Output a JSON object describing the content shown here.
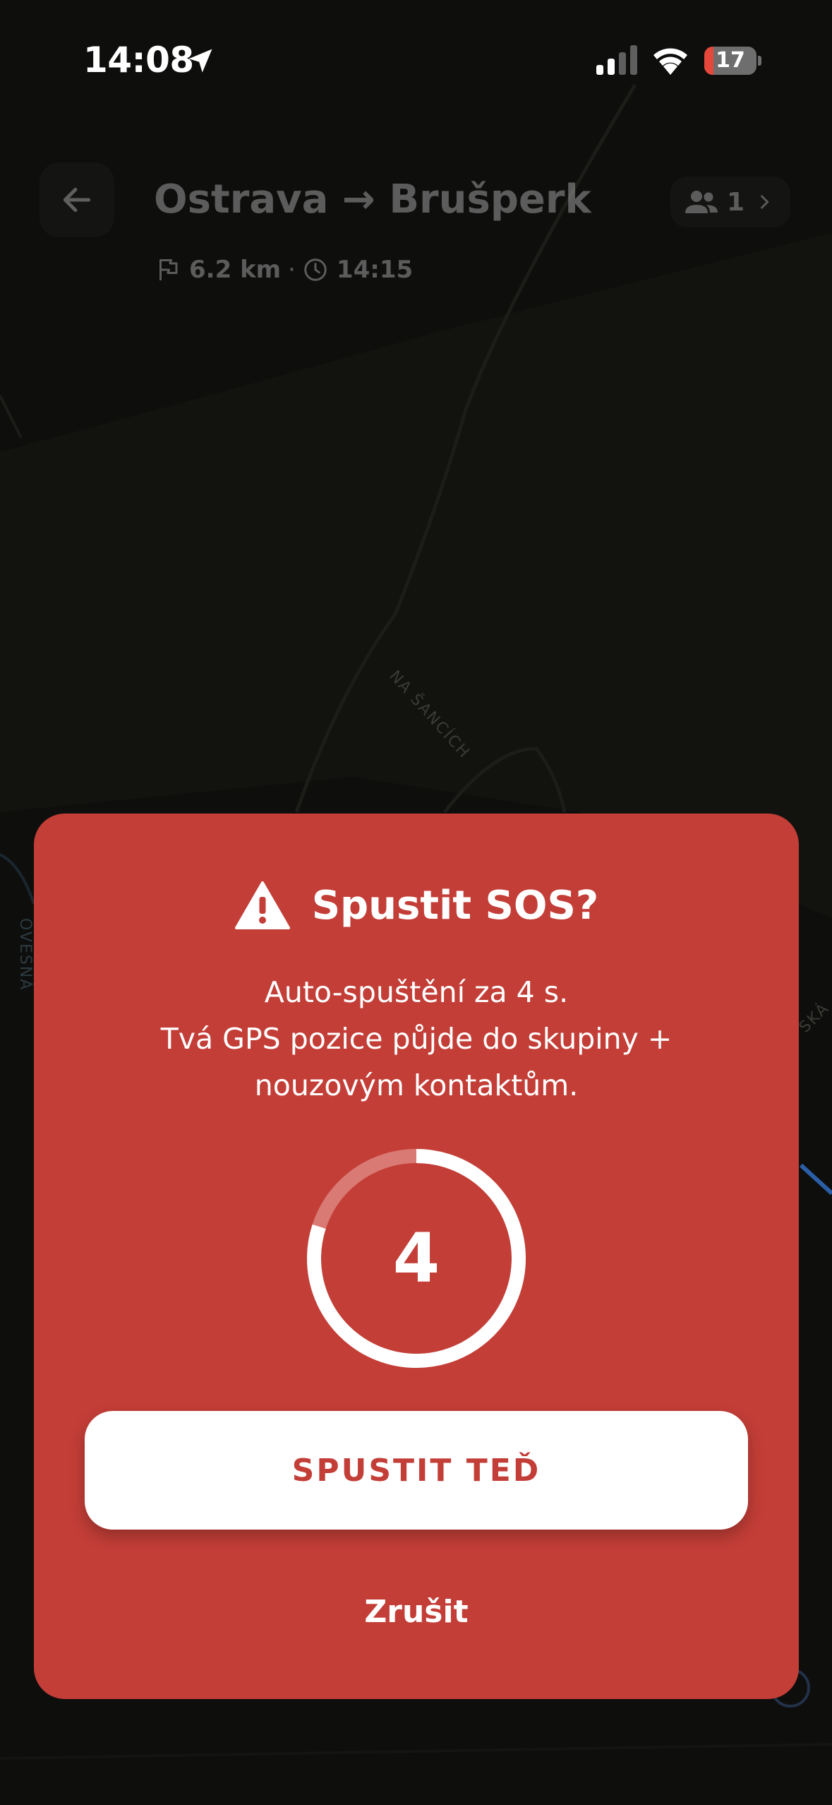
{
  "status_bar": {
    "time": "14:08",
    "battery_level": "17",
    "battery_fraction": 0.17,
    "icons": [
      "location-arrow-icon",
      "cellular-signal-icon",
      "wifi-icon",
      "battery-icon"
    ]
  },
  "map": {
    "street_labels": [
      "NA ŠANCÍCH",
      "OVESNÁ",
      "SKÁ"
    ]
  },
  "header": {
    "back_icon": "arrow-left-icon",
    "route_title": "Ostrava → Brušperk",
    "distance": "6.2 km",
    "separator": "·",
    "eta": "14:15",
    "distance_icon": "flag-icon",
    "eta_icon": "clock-icon",
    "group": {
      "icon": "people-icon",
      "count": "1",
      "chevron_icon": "chevron-right-icon"
    }
  },
  "sos_dialog": {
    "title": "Spustit SOS?",
    "title_icon": "warning-triangle-icon",
    "lines": [
      "Auto-spuštění za 4 s.",
      "Tvá GPS pozice půjde do skupiny +",
      "nouzovým kontaktům."
    ],
    "countdown_value": "4",
    "countdown_progress": 0.2,
    "launch_button": "SPUSTIT TEĎ",
    "cancel_button": "Zrušit"
  },
  "colors": {
    "dialog_red": "#c33e37",
    "button_white": "#ffffff",
    "map_dark": "#0e0e0d",
    "battery_red": "#e5483b"
  }
}
